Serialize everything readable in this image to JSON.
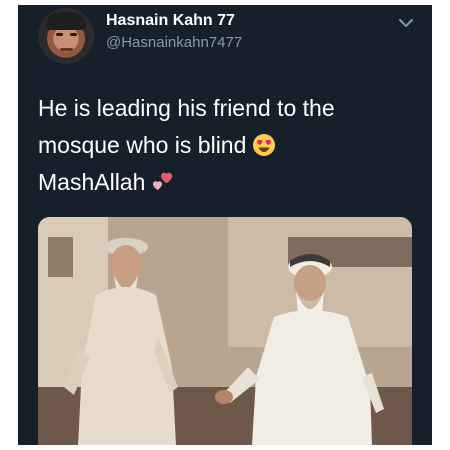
{
  "tweet": {
    "author": {
      "display_name": "Hasnain Kahn 77",
      "handle": "@Hasnainkahn7477"
    },
    "text_lines": [
      "He is leading his friend to the",
      "mosque who is blind",
      "MashAllah"
    ],
    "icons": {
      "menu": "chevron-down-icon",
      "emoji_1": "heart-eyes-emoji",
      "emoji_2": "two-hearts-emoji"
    }
  },
  "colors": {
    "background": "#15202b",
    "primary_text": "#ffffff",
    "secondary_text": "#8899a6"
  }
}
